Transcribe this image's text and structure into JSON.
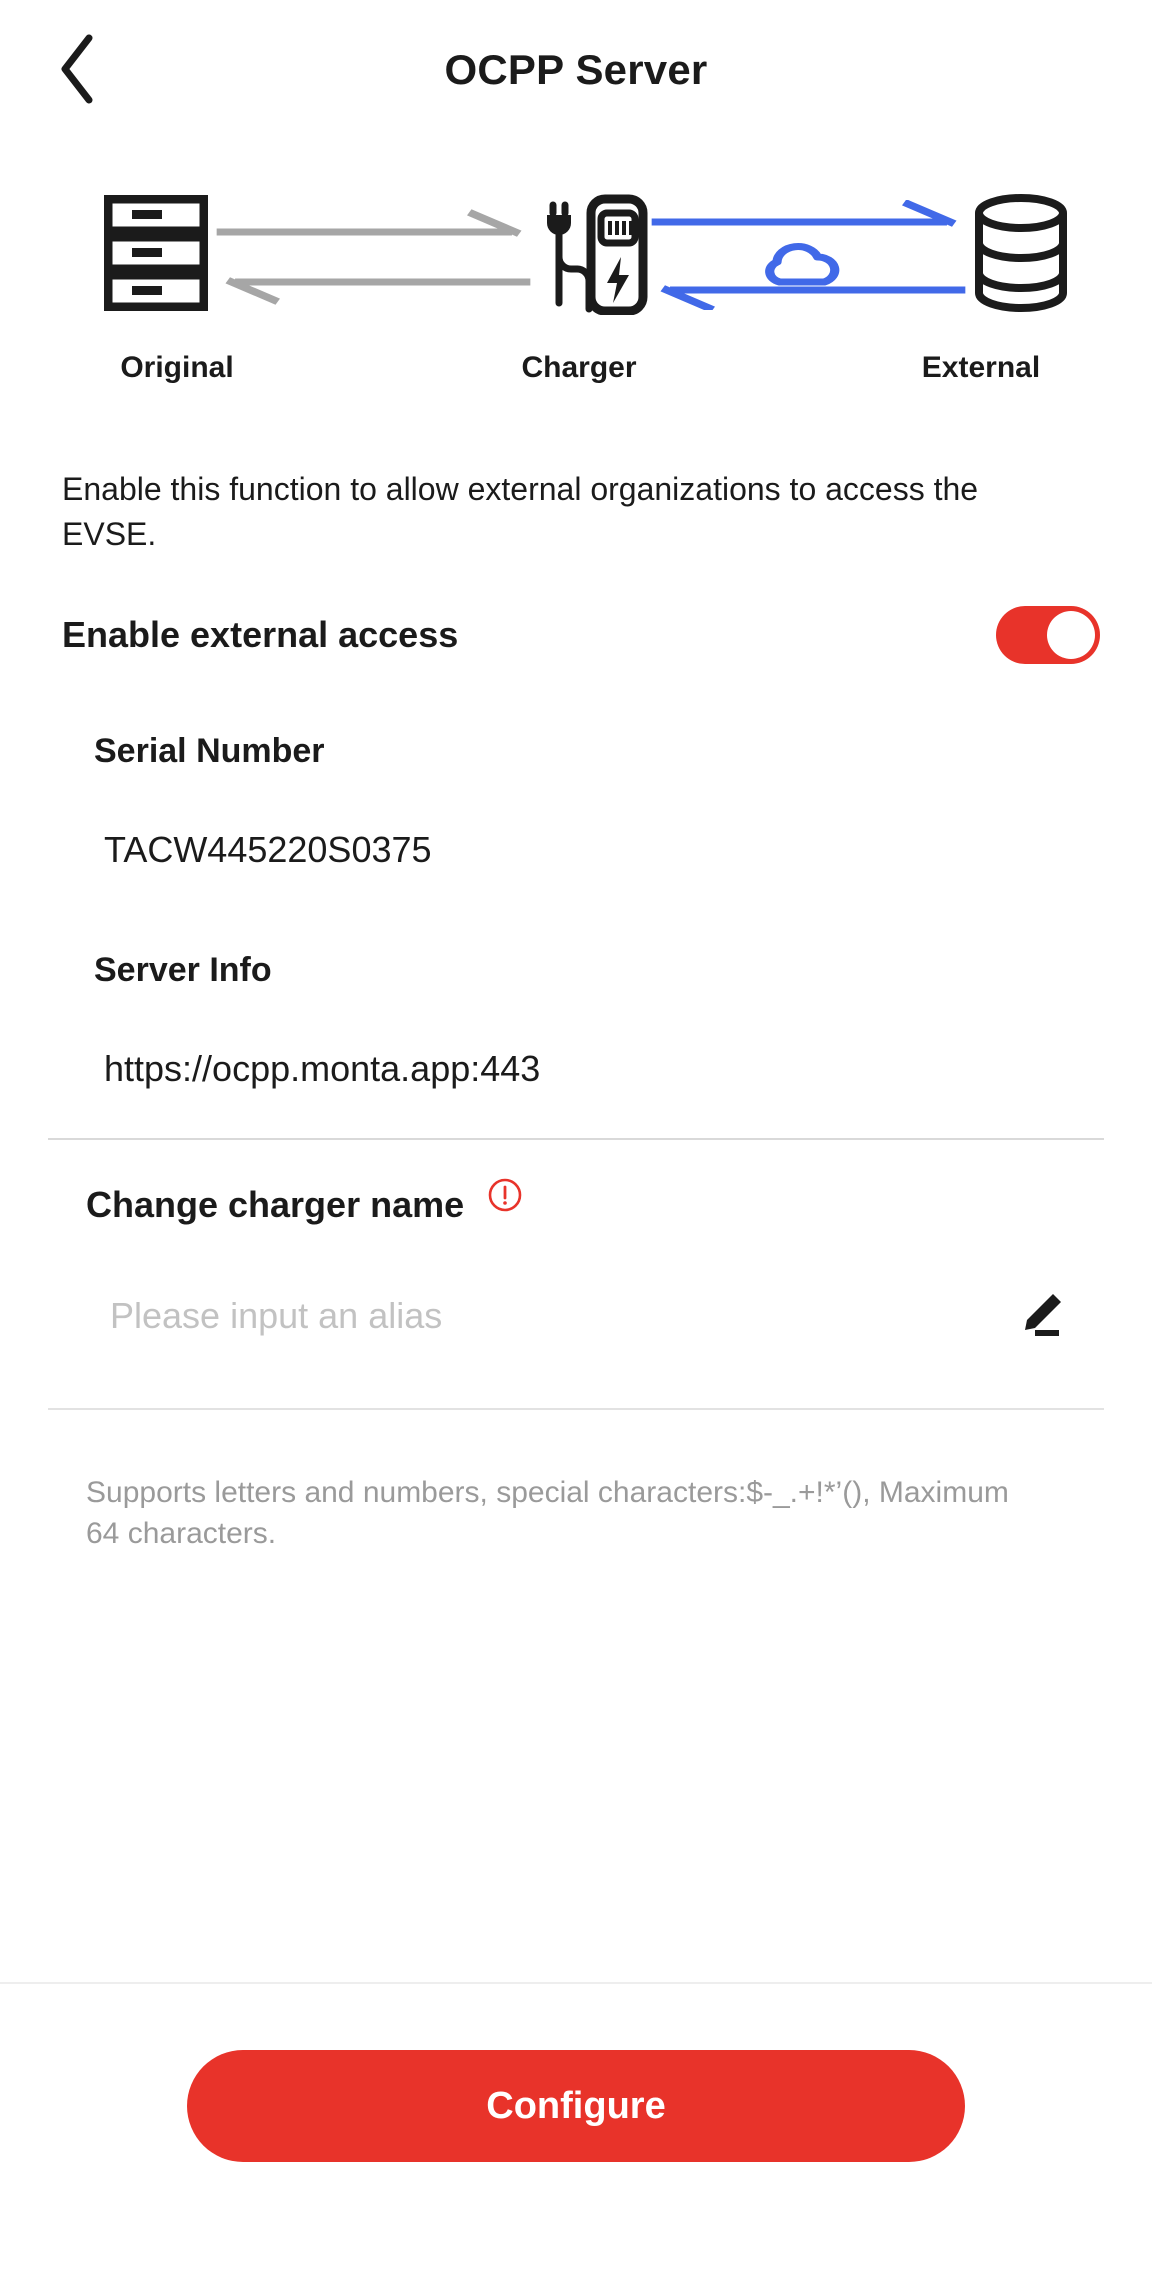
{
  "header": {
    "back_icon": "chevron-left-icon",
    "title": "OCPP Server"
  },
  "diagram": {
    "nodes": [
      {
        "icon": "server-stack-icon",
        "label": "Original"
      },
      {
        "icon": "ev-charger-icon",
        "label": "Charger"
      },
      {
        "icon": "database-icon",
        "label": "External"
      }
    ],
    "links": [
      {
        "from": "Original",
        "to": "Charger",
        "color": "#a6a6a6",
        "directions": "bidirectional"
      },
      {
        "from": "Charger",
        "to": "External",
        "color": "#4169e8",
        "directions": "bidirectional",
        "badge_icon": "cloud-icon"
      }
    ]
  },
  "main": {
    "description": "Enable this function to allow external organizations to access the EVSE.",
    "enable_label": "Enable external access",
    "enable_state": "on",
    "serial_number": {
      "title": "Serial Number",
      "value": "TACW445220S0375"
    },
    "server_info": {
      "title": "Server Info",
      "value": "https://ocpp.monta.app:443"
    },
    "change_name": {
      "label": "Change charger name",
      "warning_icon": "alert-circle-icon",
      "input_value": "",
      "input_placeholder": "Please input an alias",
      "edit_icon": "pencil-icon",
      "helper": "Supports letters and numbers, special characters:$-_.+!*’(), Maximum 64 characters."
    }
  },
  "footer": {
    "configure_label": "Configure"
  },
  "colors": {
    "accent_red": "#e8332a",
    "link_blue": "#4169e8",
    "link_gray": "#a6a6a6",
    "text_dark": "#1b1b1b",
    "text_muted": "#9a9a9a"
  }
}
